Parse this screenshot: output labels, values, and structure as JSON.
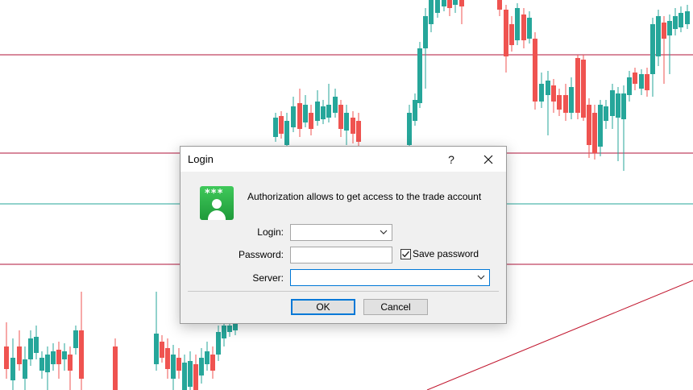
{
  "chart": {
    "colors": {
      "bull": "#26a69a",
      "bear": "#ef5350",
      "hline_red": "#b0133a",
      "hline_teal": "#26a69a",
      "trendline": "#c0132b"
    }
  },
  "dialog": {
    "title": "Login",
    "help_label": "?",
    "close_icon": "close-icon",
    "app_icon": "user-key-icon",
    "app_icon_stars": "***",
    "message": "Authorization allows to get access to the trade account",
    "login_label": "Login:",
    "login_value": "",
    "password_label": "Password:",
    "password_value": "",
    "save_password_label": "Save password",
    "save_password_checked": true,
    "server_label": "Server:",
    "server_value": "",
    "ok_label": "OK",
    "cancel_label": "Cancel"
  }
}
